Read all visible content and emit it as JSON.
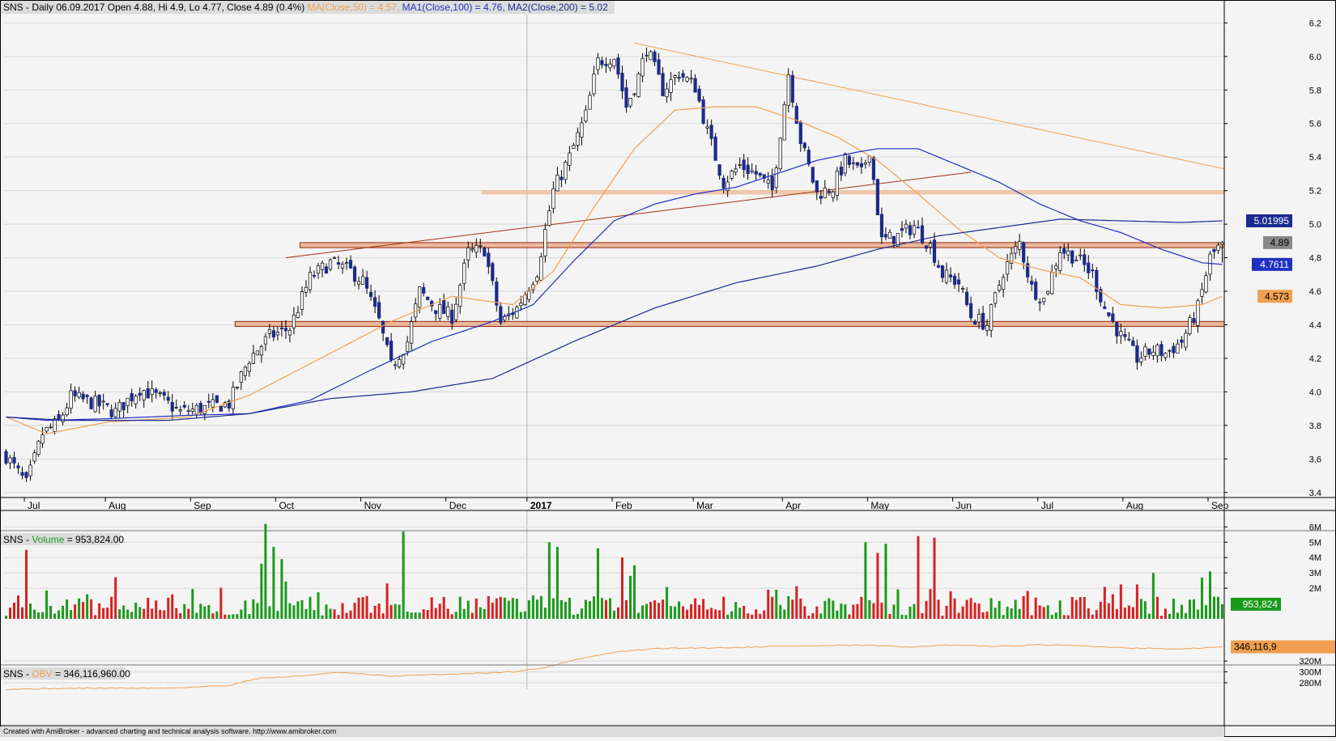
{
  "headers": {
    "price": "SNS - Daily 06.09.2017 Open 4.88, Hi 4.9, Lo 4.77, Close 4.89 (0.4%)",
    "ma_label_pre": " MA(Close,50) = 4.57, ",
    "ma1": "MA1(Close,100) = 4.76, ",
    "ma2": "MA2(Close,200) = 5.02",
    "volume_pre": "SNS - ",
    "volume_name": "Volume",
    "volume_post": " = 953,824.00",
    "obv_pre": "SNS - ",
    "obv_name": "OBV",
    "obv_post": " = 346,116,960.00"
  },
  "footer": "Created with AmiBroker - advanced charting and technical analysis software. http://www.amibroker.com",
  "colors": {
    "background": "#f4f4f4",
    "grid": "#d8d8d8",
    "candle_up": "#ffffff",
    "candle_down": "#1e2a8a",
    "ma50": "#f0a050",
    "ma100": "#2030c0",
    "ma200": "#1a2a90",
    "zone_fill": "#eca480",
    "zone_stroke": "#8a2a10",
    "trend_orange": "#f0a050",
    "trend_brown": "#a03010",
    "vol_up": "#1a9a1a",
    "vol_down": "#d82020",
    "obv": "#f0a050"
  },
  "chart_data": [
    {
      "type": "candlestick",
      "title": "SNS - Daily 06.09.2017",
      "x_tick_labels": [
        "Jul",
        "Aug",
        "Sep",
        "Oct",
        "Nov",
        "Dec",
        "2017",
        "Feb",
        "Mar",
        "Apr",
        "May",
        "Jun",
        "Jul",
        "Aug",
        "Sep"
      ],
      "x_tick_bars": [
        5,
        25,
        46,
        67,
        88,
        109,
        129,
        150,
        170,
        192,
        213,
        234,
        255,
        276,
        297
      ],
      "y_ticks": [
        3.4,
        3.6,
        3.8,
        4.0,
        4.2,
        4.4,
        4.6,
        4.8,
        5.0,
        5.2,
        5.4,
        5.6,
        5.8,
        6.0,
        6.2
      ],
      "y_tick_labels": [
        "3.4",
        "3.6",
        "3.8",
        "4.0",
        "4.2",
        "4.4",
        "4.6",
        "4.8",
        "5.0",
        "5.2",
        "5.4",
        "5.6",
        "5.8",
        "6.0",
        "6.2"
      ],
      "ylim": [
        3.37,
        6.25
      ],
      "bar_count": 301,
      "last": {
        "open": 4.88,
        "high": 4.9,
        "low": 4.77,
        "close": 4.89,
        "change_pct": 0.4
      },
      "value_tags": [
        {
          "label": "5.01995",
          "value": 5.02,
          "series": "MA2"
        },
        {
          "label": "4.89",
          "value": 4.89,
          "series": "Close"
        },
        {
          "label": "4.7611",
          "value": 4.76,
          "series": "MA1"
        },
        {
          "label": "4.573",
          "value": 4.57,
          "series": "MA"
        }
      ],
      "close_anchors": [
        [
          0,
          3.62
        ],
        [
          5,
          3.45
        ],
        [
          9,
          3.75
        ],
        [
          13,
          3.82
        ],
        [
          16,
          3.97
        ],
        [
          22,
          3.93
        ],
        [
          27,
          3.88
        ],
        [
          33,
          4.02
        ],
        [
          38,
          3.96
        ],
        [
          43,
          3.88
        ],
        [
          48,
          3.9
        ],
        [
          55,
          3.93
        ],
        [
          60,
          4.2
        ],
        [
          65,
          4.33
        ],
        [
          70,
          4.38
        ],
        [
          75,
          4.68
        ],
        [
          80,
          4.77
        ],
        [
          85,
          4.72
        ],
        [
          88,
          4.66
        ],
        [
          92,
          4.42
        ],
        [
          95,
          4.15
        ],
        [
          99,
          4.3
        ],
        [
          102,
          4.6
        ],
        [
          106,
          4.5
        ],
        [
          110,
          4.45
        ],
        [
          114,
          4.83
        ],
        [
          118,
          4.85
        ],
        [
          122,
          4.41
        ],
        [
          126,
          4.5
        ],
        [
          131,
          4.72
        ],
        [
          135,
          5.2
        ],
        [
          139,
          5.4
        ],
        [
          143,
          5.65
        ],
        [
          146,
          5.97
        ],
        [
          150,
          6.0
        ],
        [
          153,
          5.7
        ],
        [
          156,
          5.88
        ],
        [
          158,
          6.05
        ],
        [
          162,
          5.8
        ],
        [
          166,
          5.9
        ],
        [
          170,
          5.82
        ],
        [
          173,
          5.55
        ],
        [
          177,
          5.25
        ],
        [
          181,
          5.35
        ],
        [
          185,
          5.3
        ],
        [
          189,
          5.2
        ],
        [
          193,
          5.9
        ],
        [
          196,
          5.5
        ],
        [
          200,
          5.18
        ],
        [
          204,
          5.22
        ],
        [
          207,
          5.38
        ],
        [
          211,
          5.3
        ],
        [
          213,
          5.45
        ],
        [
          216,
          4.9
        ],
        [
          220,
          4.93
        ],
        [
          224,
          4.99
        ],
        [
          228,
          4.87
        ],
        [
          231,
          4.7
        ],
        [
          235,
          4.65
        ],
        [
          238,
          4.45
        ],
        [
          242,
          4.4
        ],
        [
          246,
          4.72
        ],
        [
          250,
          4.89
        ],
        [
          253,
          4.62
        ],
        [
          256,
          4.55
        ],
        [
          260,
          4.85
        ],
        [
          264,
          4.8
        ],
        [
          268,
          4.7
        ],
        [
          271,
          4.5
        ],
        [
          275,
          4.33
        ],
        [
          279,
          4.2
        ],
        [
          283,
          4.25
        ],
        [
          286,
          4.23
        ],
        [
          290,
          4.3
        ],
        [
          294,
          4.5
        ],
        [
          297,
          4.8
        ],
        [
          300,
          4.89
        ]
      ],
      "ma50_anchors": [
        [
          0,
          3.85
        ],
        [
          10,
          3.75
        ],
        [
          25,
          3.82
        ],
        [
          45,
          3.85
        ],
        [
          60,
          3.98
        ],
        [
          80,
          4.23
        ],
        [
          95,
          4.42
        ],
        [
          110,
          4.57
        ],
        [
          125,
          4.52
        ],
        [
          135,
          4.72
        ],
        [
          145,
          5.1
        ],
        [
          155,
          5.45
        ],
        [
          165,
          5.68
        ],
        [
          175,
          5.7
        ],
        [
          185,
          5.7
        ],
        [
          195,
          5.62
        ],
        [
          205,
          5.52
        ],
        [
          215,
          5.38
        ],
        [
          225,
          5.18
        ],
        [
          235,
          4.97
        ],
        [
          245,
          4.8
        ],
        [
          255,
          4.73
        ],
        [
          265,
          4.68
        ],
        [
          275,
          4.52
        ],
        [
          285,
          4.5
        ],
        [
          295,
          4.52
        ],
        [
          300,
          4.57
        ]
      ],
      "ma100_anchors": [
        [
          0,
          3.85
        ],
        [
          10,
          3.83
        ],
        [
          25,
          3.84
        ],
        [
          45,
          3.86
        ],
        [
          60,
          3.87
        ],
        [
          75,
          3.95
        ],
        [
          90,
          4.13
        ],
        [
          105,
          4.3
        ],
        [
          120,
          4.42
        ],
        [
          130,
          4.52
        ],
        [
          140,
          4.78
        ],
        [
          150,
          5.02
        ],
        [
          160,
          5.12
        ],
        [
          170,
          5.18
        ],
        [
          180,
          5.22
        ],
        [
          190,
          5.3
        ],
        [
          200,
          5.38
        ],
        [
          210,
          5.43
        ],
        [
          215,
          5.45
        ],
        [
          225,
          5.45
        ],
        [
          235,
          5.35
        ],
        [
          245,
          5.25
        ],
        [
          255,
          5.12
        ],
        [
          265,
          5.02
        ],
        [
          275,
          4.95
        ],
        [
          285,
          4.85
        ],
        [
          295,
          4.77
        ],
        [
          300,
          4.76
        ]
      ],
      "ma200_anchors": [
        [
          0,
          3.85
        ],
        [
          15,
          3.83
        ],
        [
          40,
          3.83
        ],
        [
          60,
          3.87
        ],
        [
          80,
          3.96
        ],
        [
          100,
          4.0
        ],
        [
          120,
          4.08
        ],
        [
          140,
          4.3
        ],
        [
          160,
          4.5
        ],
        [
          180,
          4.65
        ],
        [
          200,
          4.75
        ],
        [
          215,
          4.85
        ],
        [
          230,
          4.93
        ],
        [
          245,
          4.98
        ],
        [
          260,
          5.03
        ],
        [
          275,
          5.02
        ],
        [
          290,
          5.01
        ],
        [
          300,
          5.02
        ]
      ],
      "zones": [
        [
          4.86,
          4.89
        ],
        [
          4.39,
          4.42
        ],
        [
          5.18,
          5.2
        ]
      ],
      "zone_bars": [
        [
          73,
          301
        ],
        [
          57,
          301
        ],
        [
          118,
          301
        ]
      ],
      "trendlines": [
        {
          "color": "orange",
          "from": [
            155,
            6.08
          ],
          "to": [
            301,
            5.33
          ]
        },
        {
          "color": "brown",
          "from": [
            69,
            4.8
          ],
          "to": [
            238,
            5.31
          ]
        }
      ]
    },
    {
      "type": "bar",
      "title": "SNS - Volume = 953,824.00",
      "y_ticks": [
        2000000,
        3000000,
        4000000,
        5000000,
        6000000
      ],
      "y_tick_labels": [
        "2M",
        "3M",
        "4M",
        "5M",
        "6M"
      ],
      "ylim": [
        0,
        6600000
      ],
      "last_value": 953824,
      "last_label": "953,824",
      "spikes": [
        [
          5,
          4500000
        ],
        [
          63,
          3600000
        ],
        [
          64,
          6200000
        ],
        [
          66,
          4700000
        ],
        [
          68,
          3900000
        ],
        [
          98,
          5700000
        ],
        [
          134,
          5000000
        ],
        [
          136,
          4700000
        ],
        [
          146,
          4600000
        ],
        [
          152,
          4000000
        ],
        [
          155,
          3500000
        ],
        [
          212,
          5000000
        ],
        [
          215,
          4300000
        ],
        [
          217,
          4900000
        ],
        [
          225,
          5400000
        ],
        [
          229,
          5300000
        ],
        [
          283,
          3000000
        ],
        [
          295,
          2700000
        ],
        [
          297,
          3100000
        ]
      ]
    },
    {
      "type": "line",
      "title": "SNS - OBV = 346,116,960.00",
      "y_ticks": [
        280000000,
        300000000,
        320000000
      ],
      "y_tick_labels": [
        "280M",
        "300M",
        "320M"
      ],
      "ylim": [
        268000000,
        350000000
      ],
      "last_value": 346116960,
      "last_label": "346,116,9",
      "anchors": [
        [
          0,
          268000000
        ],
        [
          20,
          270000000
        ],
        [
          40,
          270000000
        ],
        [
          55,
          275000000
        ],
        [
          62,
          288000000
        ],
        [
          72,
          292000000
        ],
        [
          82,
          299000000
        ],
        [
          95,
          292000000
        ],
        [
          110,
          296000000
        ],
        [
          125,
          300000000
        ],
        [
          133,
          308000000
        ],
        [
          140,
          322000000
        ],
        [
          150,
          336000000
        ],
        [
          160,
          343000000
        ],
        [
          170,
          344000000
        ],
        [
          180,
          345000000
        ],
        [
          190,
          347000000
        ],
        [
          200,
          348000000
        ],
        [
          212,
          349000000
        ],
        [
          222,
          346000000
        ],
        [
          232,
          349000000
        ],
        [
          245,
          347000000
        ],
        [
          255,
          350000000
        ],
        [
          265,
          348000000
        ],
        [
          278,
          344000000
        ],
        [
          290,
          342000000
        ],
        [
          300,
          346000000
        ]
      ]
    }
  ]
}
